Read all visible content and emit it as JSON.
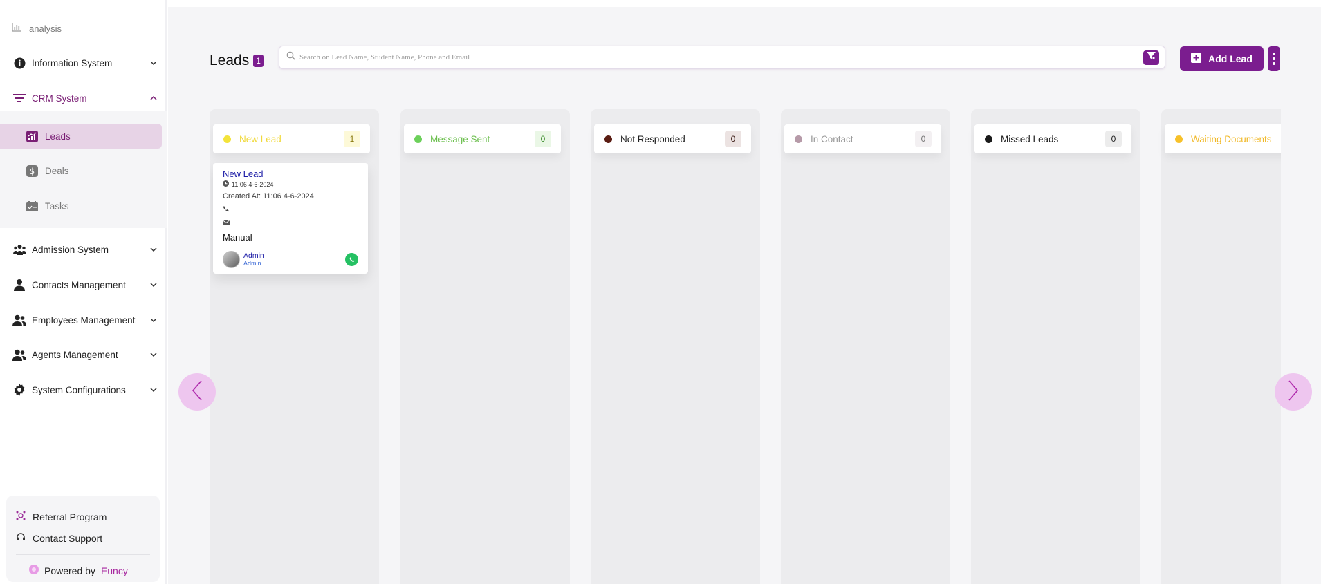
{
  "sidebar": {
    "analysis_label": "analysis",
    "sections": [
      {
        "label": "Information System",
        "icon": "info-icon",
        "expanded": false
      },
      {
        "label": "CRM System",
        "icon": "filter-lines-icon",
        "expanded": true
      },
      {
        "label": "Admission System",
        "icon": "users-group-icon",
        "expanded": false
      },
      {
        "label": "Contacts Management",
        "icon": "user-icon",
        "expanded": false
      },
      {
        "label": "Employees Management",
        "icon": "users-icon",
        "expanded": false
      },
      {
        "label": "Agents Management",
        "icon": "users-icon",
        "expanded": false
      },
      {
        "label": "System Configurations",
        "icon": "gear-icon",
        "expanded": false
      }
    ],
    "crm_items": [
      {
        "label": "Leads",
        "icon": "chart-icon",
        "active": true
      },
      {
        "label": "Deals",
        "icon": "dollar-icon",
        "active": false
      },
      {
        "label": "Tasks",
        "icon": "tasks-icon",
        "active": false
      }
    ],
    "footer": {
      "referral": "Referral Program",
      "support": "Contact Support",
      "powered_prefix": "Powered by",
      "powered_brand": "Euncy"
    }
  },
  "header": {
    "title": "Leads",
    "count": "1",
    "search_placeholder": "Search on Lead Name, Student Name, Phone and Email",
    "add_button": "Add Lead"
  },
  "columns": [
    {
      "name": "New Lead",
      "count": "1",
      "dot": "#f3e33a",
      "text_color": "#f0d93a",
      "badge_bg": "#fdf9d8",
      "badge_color": "#8a7a10"
    },
    {
      "name": "Message Sent",
      "count": "0",
      "dot": "#6cd05a",
      "text_color": "#6cbf4e",
      "badge_bg": "#eaf7e6",
      "badge_color": "#3a8a2a"
    },
    {
      "name": "Not Responded",
      "count": "0",
      "dot": "#5a1c12",
      "text_color": "#222222",
      "badge_bg": "#ece3e2",
      "badge_color": "#3a1a14"
    },
    {
      "name": "In Contact",
      "count": "0",
      "dot": "#b69aa8",
      "text_color": "#999999",
      "badge_bg": "#f3f0f2",
      "badge_color": "#777777"
    },
    {
      "name": "Missed Leads",
      "count": "0",
      "dot": "#1a1a1a",
      "text_color": "#222222",
      "badge_bg": "#ececec",
      "badge_color": "#222222"
    },
    {
      "name": "Waiting Documents",
      "count": "",
      "dot": "#f7c12a",
      "text_color": "#f1b928",
      "badge_bg": "#ffffff",
      "badge_color": "#000000"
    }
  ],
  "lead_card": {
    "name": "New Lead",
    "time": "11:06 4-6-2024",
    "created": "Created At: 11:06 4-6-2024",
    "source": "Manual",
    "owner_name": "Admin",
    "owner_role": "Admin"
  }
}
